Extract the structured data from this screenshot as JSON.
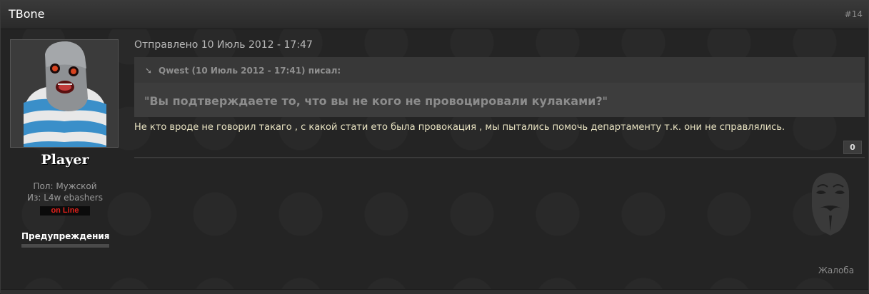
{
  "post": {
    "author": "TBone",
    "number": "#14",
    "posted": "Отправлено 10 Июль 2012 - 17:47",
    "quote": {
      "citation": "Qwest (10 Июль 2012 - 17:41) писал:",
      "open_mark": "\"",
      "text": "Вы подтверждаете то, что вы не кого не провоцировали кулаками?",
      "close_mark": "\""
    },
    "body": "Не кто вроде не говорил такаго , с какой стати ето была провокация , мы пытались помочь департаменту т.к. они не справлялись.",
    "reputation": "0",
    "report_label": "Жалоба"
  },
  "profile": {
    "rank": "Player",
    "gender": "Пол: Мужской",
    "from": "Из: L4w ebashers",
    "status": "on Line",
    "warnings_label": "Предупреждения"
  },
  "colors": {
    "status": "#e0201a",
    "body_text": "#e9e3c2",
    "background": "#242424"
  }
}
